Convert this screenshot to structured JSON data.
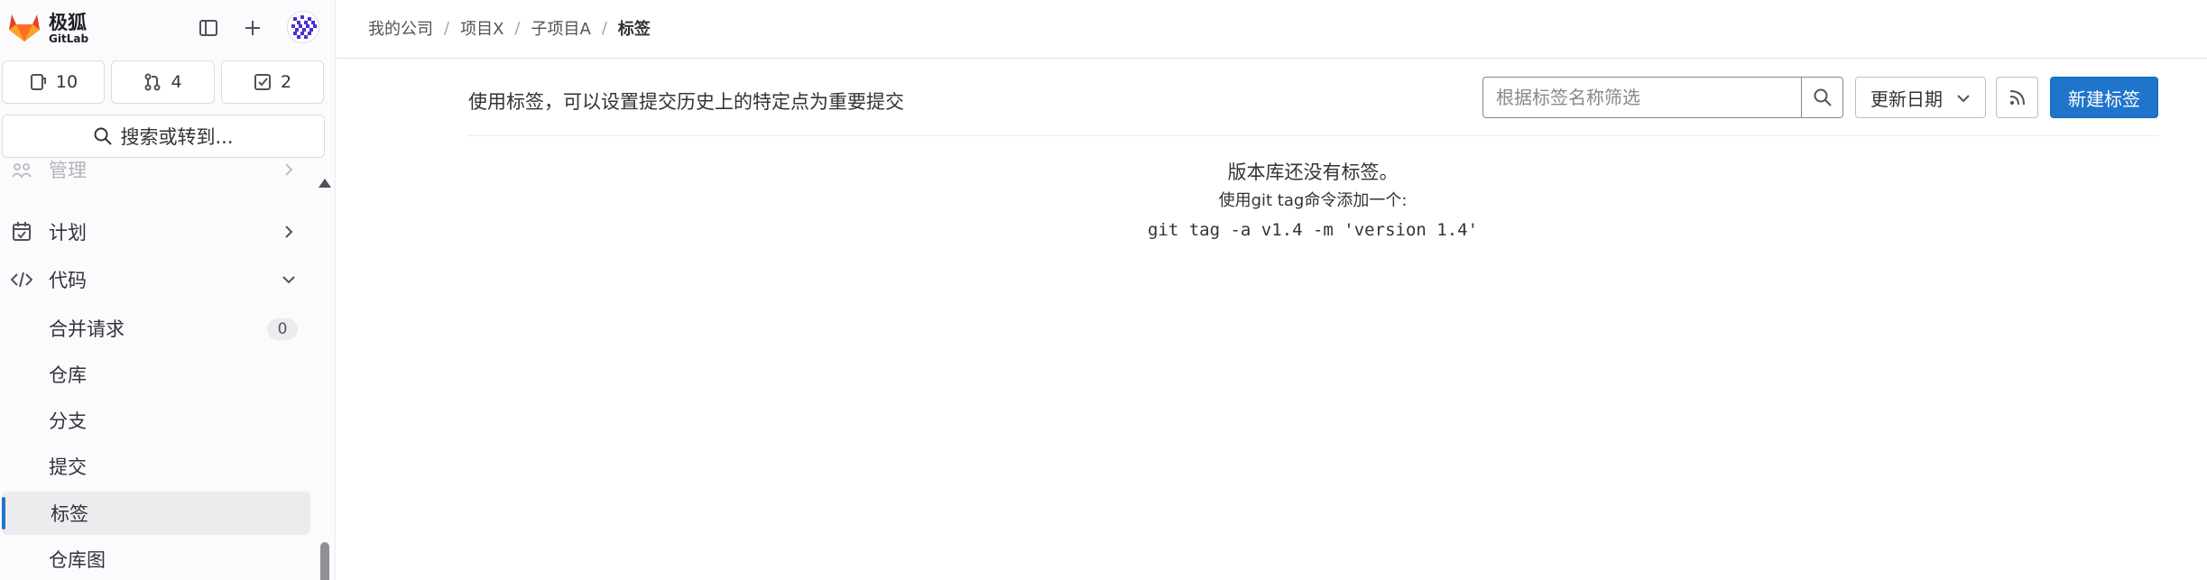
{
  "sidebar": {
    "brand": {
      "name": "极狐",
      "sub": "GitLab"
    },
    "top_buttons": {
      "toggle": "sidebar-toggle-icon",
      "create": "plus-icon"
    },
    "counts": [
      {
        "icon": "issue-icon",
        "value": "10"
      },
      {
        "icon": "merge-request-icon",
        "value": "4"
      },
      {
        "icon": "todo-icon",
        "value": "2"
      }
    ],
    "search_label": "搜索或转到...",
    "nav": [
      {
        "label": "管理",
        "icon": "admin-icon"
      },
      {
        "label": "计划",
        "icon": "calendar-icon"
      },
      {
        "label": "代码",
        "icon": "code-icon"
      }
    ],
    "code_items": [
      {
        "label": "合并请求",
        "count": "0"
      },
      {
        "label": "仓库"
      },
      {
        "label": "分支"
      },
      {
        "label": "提交"
      },
      {
        "label": "标签",
        "active": true
      },
      {
        "label": "仓库图"
      }
    ]
  },
  "breadcrumb": {
    "items": [
      "我的公司",
      "项目X",
      "子项目A"
    ],
    "separator": "/",
    "current": "标签"
  },
  "tags_page": {
    "description": "使用标签，可以设置提交历史上的特定点为重要提交",
    "filter_placeholder": "根据标签名称筛选",
    "sort_label": "更新日期",
    "new_button": "新建标签",
    "empty_title": "版本库还没有标签。",
    "empty_hint": "使用git tag命令添加一个:",
    "empty_command": "git tag -a v1.4 -m 'version 1.4'"
  },
  "colors": {
    "primary": "#1f75cb",
    "brand_orange": "#e24329"
  }
}
